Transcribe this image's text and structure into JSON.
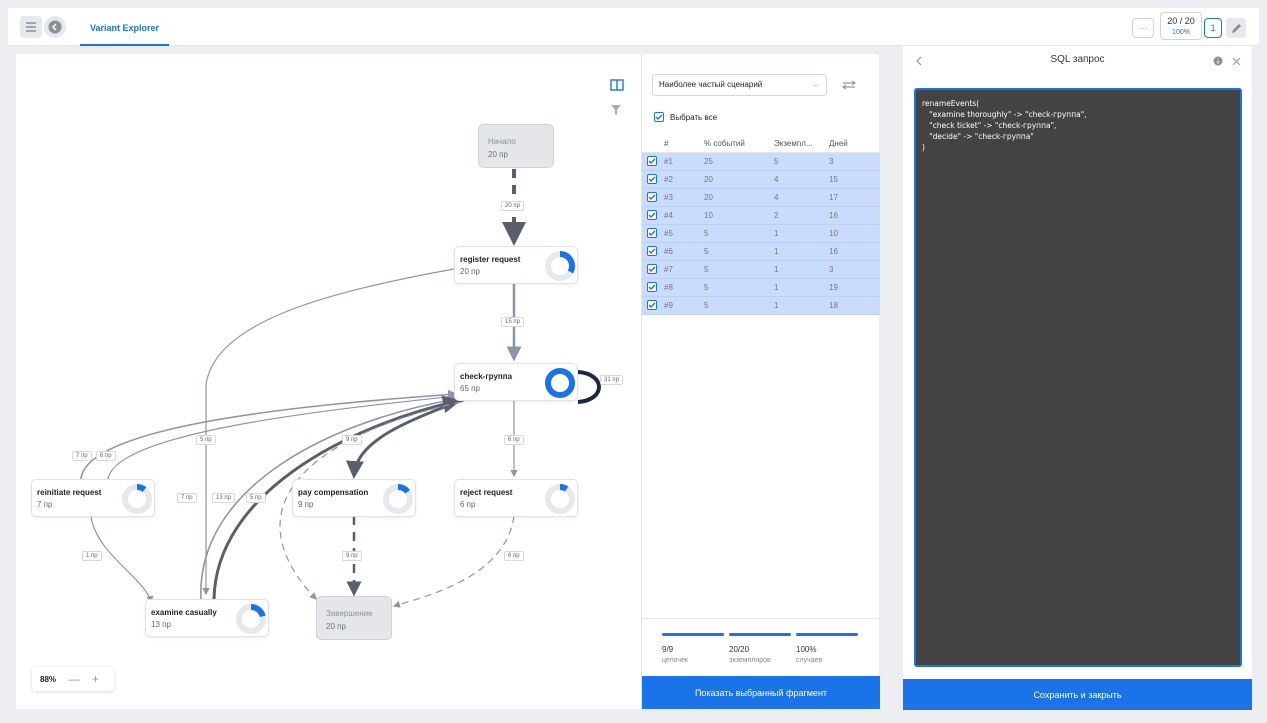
{
  "topbar": {
    "tab_label": "Variant Explorer",
    "counter_main": "20 / 20",
    "counter_sub": "100%",
    "more_label": "···",
    "page_label": "1"
  },
  "graph": {
    "zoom_value": "88%",
    "zoom_minus": "—",
    "zoom_plus": "+",
    "nodes": {
      "start": {
        "title": "Начало",
        "count": "20 пр"
      },
      "register": {
        "title": "register request",
        "count": "20 пр"
      },
      "check": {
        "title": "check-группа",
        "count": "65 пр"
      },
      "reinitiate": {
        "title": "reinitiate request",
        "count": "7 пр"
      },
      "pay": {
        "title": "pay compensation",
        "count": "9 пр"
      },
      "reject": {
        "title": "reject request",
        "count": "6 пр"
      },
      "examine": {
        "title": "examine casually",
        "count": "13 пр"
      },
      "end": {
        "title": "Завершение",
        "count": "20 пр"
      }
    },
    "edge_labels": {
      "start_register": "20 пр",
      "register_check": "15 пр",
      "check_loop": "31 пр",
      "register_examine": "5 пр",
      "reinit_check_a": "7 пр",
      "reinit_check_b": "6 пр",
      "check_pay": "9 пр",
      "check_reject": "6 пр",
      "examine_check_a": "7 пр",
      "examine_check_b": "13 пр",
      "check_end_dashed": "5 пр",
      "reinit_examine": "1 пр",
      "pay_end": "9 пр",
      "reject_end": "6 пр"
    }
  },
  "scenario": {
    "select_value": "Наиболее частый сценарий",
    "select_all_label": "Выбрать все",
    "columns": [
      "#",
      "% событий",
      "Экземпл...",
      "Дней"
    ],
    "rows": [
      [
        "#1",
        "25",
        "5",
        "3"
      ],
      [
        "#2",
        "20",
        "4",
        "15"
      ],
      [
        "#3",
        "20",
        "4",
        "17"
      ],
      [
        "#4",
        "10",
        "2",
        "16"
      ],
      [
        "#5",
        "5",
        "1",
        "10"
      ],
      [
        "#6",
        "5",
        "1",
        "16"
      ],
      [
        "#7",
        "5",
        "1",
        "3"
      ],
      [
        "#8",
        "5",
        "1",
        "19"
      ],
      [
        "#9",
        "5",
        "1",
        "18"
      ]
    ],
    "stats": [
      {
        "value": "9/9",
        "label": "цепочек"
      },
      {
        "value": "20/20",
        "label": "экземпляров"
      },
      {
        "value": "100%",
        "label": "случаев"
      }
    ],
    "show_button": "Показать выбранный фрагмент"
  },
  "sql": {
    "title": "SQL запрос",
    "code_lines": [
      "renameEvents(",
      "   \"examine thoroughly\" -> \"check-группа\",",
      "   \"check ticket\" -> \"check-группа\",",
      "   \"decide\" -> \"check-группа\"",
      ")"
    ],
    "save_button": "Сохранить и закрыть"
  },
  "colors": {
    "accent": "#1a73e8",
    "row_selected": "#c9dcfb",
    "editor_bg": "#434343",
    "edge": "#8f95a3"
  }
}
